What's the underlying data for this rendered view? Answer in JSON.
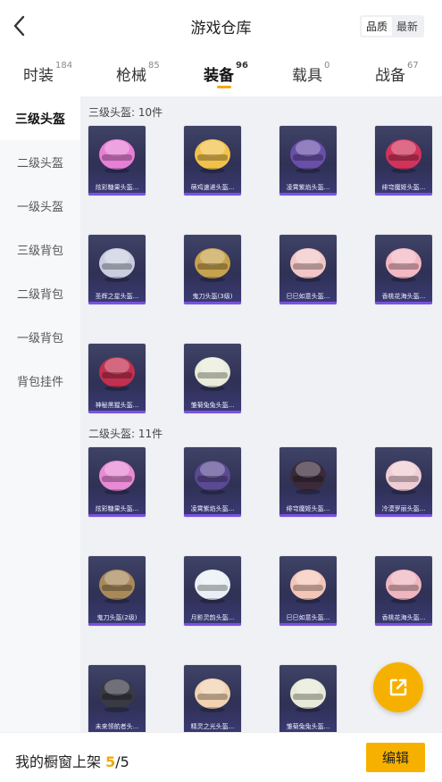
{
  "header": {
    "title": "游戏仓库",
    "sort_options": [
      "品质",
      "最新"
    ]
  },
  "tabs": [
    {
      "label": "时装",
      "count": "184"
    },
    {
      "label": "枪械",
      "count": "85"
    },
    {
      "label": "装备",
      "count": "96",
      "active": true
    },
    {
      "label": "载具",
      "count": "0"
    },
    {
      "label": "战备",
      "count": "67"
    }
  ],
  "sidebar": {
    "items": [
      "三级头盔",
      "二级头盔",
      "一级头盔",
      "三级背包",
      "二级背包",
      "一级背包",
      "背包挂件"
    ]
  },
  "sections": [
    {
      "title": "三级头盔: 10件",
      "items": [
        {
          "name": "炫彩糖果头盔...",
          "color": "#e87fd6"
        },
        {
          "name": "萌鸡速递头盔...",
          "color": "#f1c24b"
        },
        {
          "name": "凌霄紫焰头盔...",
          "color": "#6a4fa8"
        },
        {
          "name": "绯穹魔姬头盔...",
          "color": "#d2335a"
        },
        {
          "name": "圣辉之星头盔...",
          "color": "#c9cde0"
        },
        {
          "name": "鬼刀头盔(3级)",
          "color": "#c6a24d"
        },
        {
          "name": "巳巳如意头盔...",
          "color": "#f2c6c6"
        },
        {
          "name": "香桃花海头盔...",
          "color": "#f3b8c2"
        },
        {
          "name": "神秘黑猩头盔...",
          "color": "#c2304f"
        },
        {
          "name": "雏菊兔兔头盔...",
          "color": "#e8ecd8"
        }
      ]
    },
    {
      "title": "二级头盔: 11件",
      "items": [
        {
          "name": "炫彩糖果头盔...",
          "color": "#e88ad4"
        },
        {
          "name": "凌霄紫焰头盔...",
          "color": "#5a4a92"
        },
        {
          "name": "绯穹魔姬头盔...",
          "color": "#3a2a3a"
        },
        {
          "name": "冷漠罗丽头盔...",
          "color": "#f0cdd4"
        },
        {
          "name": "鬼刀头盔(2级)",
          "color": "#a88a5a"
        },
        {
          "name": "月影灵韵头盔...",
          "color": "#e8f0f6"
        },
        {
          "name": "巳巳如意头盔...",
          "color": "#f4c6b8"
        },
        {
          "name": "香桃花海头盔...",
          "color": "#f0b6c0"
        },
        {
          "name": "未来领航者头...",
          "color": "#3a3a44"
        },
        {
          "name": "精灵之光头盔...",
          "color": "#f2d2b0"
        },
        {
          "name": "雏菊兔兔头盔...",
          "color": "#e6ead6"
        }
      ]
    }
  ],
  "footer": {
    "label": "我的橱窗上架",
    "current": "5",
    "total": "/5",
    "edit_label": "编辑"
  },
  "icons": {
    "back": "chevron-left-icon",
    "share": "external-link-icon"
  },
  "colors": {
    "accent": "#f6b100",
    "card_bg": "#2f3155",
    "rarity_purple": "#7b52e0"
  }
}
